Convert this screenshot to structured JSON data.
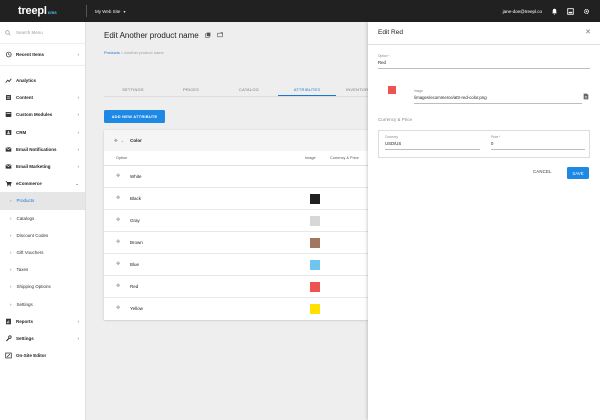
{
  "app": {
    "logo": "treepl",
    "logo_suffix": "cms",
    "site_name": "My Web Site",
    "user_email": "jane-doe@treepl.co"
  },
  "sidebar": {
    "search_placeholder": "Search Menu",
    "recent": "Recent Items",
    "items": [
      {
        "label": "Analytics",
        "icon": "analytics-icon"
      },
      {
        "label": "Content",
        "icon": "content-icon"
      },
      {
        "label": "Custom Modules",
        "icon": "modules-icon"
      },
      {
        "label": "CRM",
        "icon": "crm-icon"
      },
      {
        "label": "Email Notifications",
        "icon": "email-notifications-icon"
      },
      {
        "label": "Email Marketing",
        "icon": "email-marketing-icon"
      },
      {
        "label": "eCommerce",
        "icon": "cart-icon"
      },
      {
        "label": "Reports",
        "icon": "reports-icon"
      },
      {
        "label": "Settings",
        "icon": "wrench-icon"
      },
      {
        "label": "On-Site Editor",
        "icon": "editor-icon"
      }
    ],
    "ecommerce_sub": [
      "Products",
      "Catalogs",
      "Discount Codes",
      "Gift Vouchers",
      "Taxes",
      "Shipping Options",
      "Settings"
    ]
  },
  "main": {
    "title": "Edit Another product name",
    "breadcrumb_link": "Products",
    "breadcrumb_sep": ">",
    "breadcrumb_current": "Another product name",
    "tabs": [
      "SETTINGS",
      "PRICES",
      "CATALOG",
      "ATTRIBUTES",
      "INVENTORY"
    ],
    "active_tab": "ATTRIBUTES",
    "add_button": "ADD NEW ATTRIBUTE",
    "attribute_name": "Color",
    "columns": {
      "option": "Option",
      "image": "Image",
      "currency": "Currency & Price"
    },
    "options": [
      {
        "name": "White",
        "color": null
      },
      {
        "name": "Black",
        "color": "#212121"
      },
      {
        "name": "Gray",
        "color": "#d7d7d7"
      },
      {
        "name": "Brown",
        "color": "#a1785f"
      },
      {
        "name": "Blue",
        "color": "#6ec6f0"
      },
      {
        "name": "Red",
        "color": "#ef5350"
      },
      {
        "name": "Yellow",
        "color": "#ffe000"
      }
    ]
  },
  "drawer": {
    "title": "Edit Red",
    "option_label": "Option *",
    "option_value": "Red",
    "image_label": "Image",
    "image_value": "/images/ecommerce/attr-red-color.png",
    "image_color": "#ef5350",
    "section_title": "Currency & Price",
    "currency_label": "Currency",
    "currency_value": "USD/US",
    "price_label": "Price *",
    "price_value": "0",
    "cancel": "CANCEL",
    "save": "SAVE"
  },
  "colors": {
    "accent": "#1e88e5",
    "topbar": "#212121",
    "brand_suffix": "#4fc3f7"
  }
}
